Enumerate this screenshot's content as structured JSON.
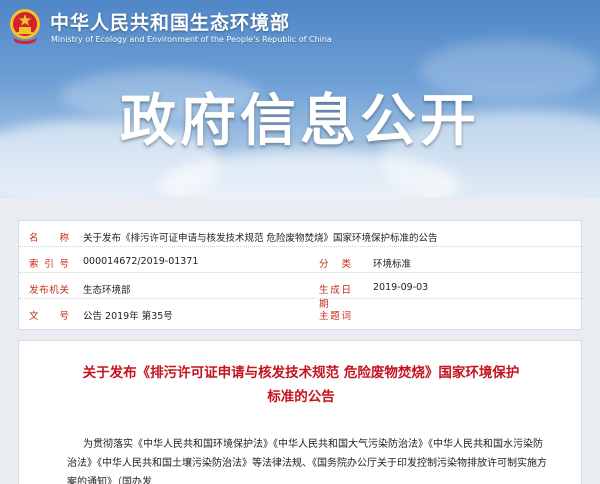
{
  "header": {
    "ministry_cn": "中华人民共和国生态环境部",
    "ministry_en": "Ministry of Ecology and Environment of the People's Republic of China",
    "banner_title": "政府信息公开",
    "emblem_icon": "national-emblem-icon",
    "colors": {
      "banner_blue": "#4f86c6",
      "emblem_red": "#d3232a",
      "emblem_gold": "#f2c230"
    }
  },
  "info": {
    "name_label": "名称",
    "name_value": "关于发布《排污许可证申请与核发技术规范 危险废物焚烧》国家环境保护标准的公告",
    "index_label": "索引号",
    "index_value": "000014672/2019-01371",
    "category_label": "分类",
    "category_value": "环境标准",
    "publisher_label": "发布机关",
    "publisher_value": "生态环境部",
    "date_label": "生成日期",
    "date_value": "2019-09-03",
    "docno_label": "文号",
    "docno_value": "公告 2019年 第35号",
    "keywords_label": "主题词",
    "keywords_value": "",
    "label_color": "#c52c1a"
  },
  "article": {
    "title": "关于发布《排污许可证申请与核发技术规范 危险废物焚烧》国家环境保护标准的公告",
    "title_color": "#c4131e",
    "body": "为贯彻落实《中华人民共和国环境保护法》《中华人民共和国大气污染防治法》《中华人民共和国水污染防治法》《中华人民共和国土壤污染防治法》等法律法规、《国务院办公厅关于印发控制污染物排放许可制实施方案的通知》（国办发"
  }
}
